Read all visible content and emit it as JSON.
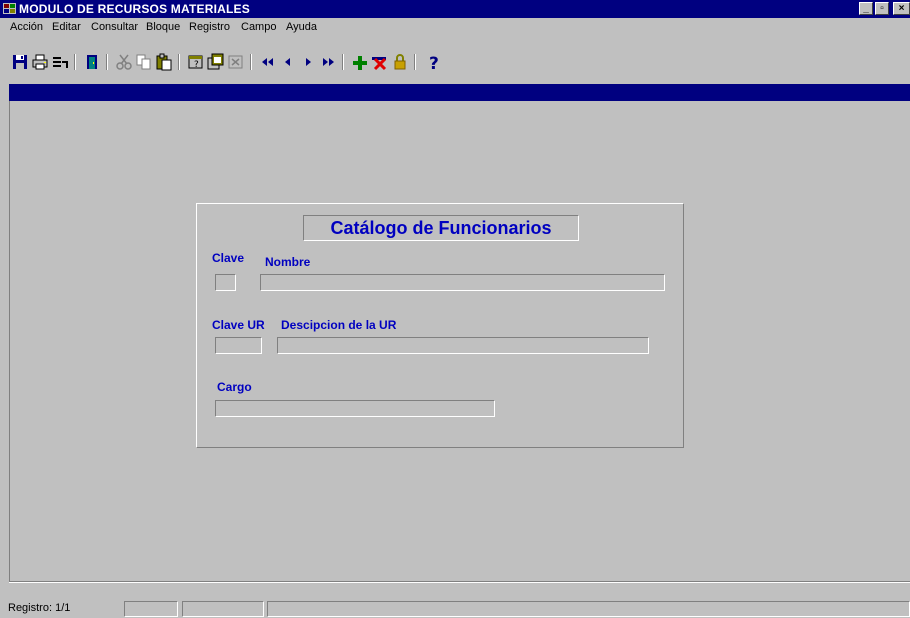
{
  "window": {
    "title": "MODULO DE RECURSOS MATERIALES",
    "buttons": [
      "minimize",
      "maximize",
      "close"
    ]
  },
  "menu": [
    {
      "label": "Acción"
    },
    {
      "label": "Editar"
    },
    {
      "label": "Consultar"
    },
    {
      "label": "Bloque"
    },
    {
      "label": "Registro"
    },
    {
      "label": "Campo"
    },
    {
      "label": "Ayuda"
    }
  ],
  "toolbar": {
    "icons": [
      "save-icon",
      "print-icon",
      "print-setup-icon",
      "exit-icon",
      "cut-icon",
      "copy-icon",
      "paste-icon",
      "enter-query-icon",
      "execute-query-icon",
      "cancel-query-icon",
      "first-record-icon",
      "previous-record-icon",
      "next-record-icon",
      "last-record-icon",
      "insert-record-icon",
      "delete-record-icon",
      "lock-record-icon",
      "help-icon"
    ]
  },
  "form": {
    "title": "Catálogo de Funcionarios",
    "clave_label": "Clave",
    "clave_value": "",
    "nombre_label": "Nombre",
    "nombre_value": "",
    "clave_ur_label": "Clave UR",
    "clave_ur_value": "",
    "descripcion_ur_label": "Descipcion de la UR",
    "descripcion_ur_value": "",
    "cargo_label": "Cargo",
    "cargo_value": ""
  },
  "status": {
    "record": "Registro: 1/1"
  },
  "colors": {
    "titlebar": "#000080",
    "label": "#0000c0",
    "face": "#c0c0c0"
  }
}
